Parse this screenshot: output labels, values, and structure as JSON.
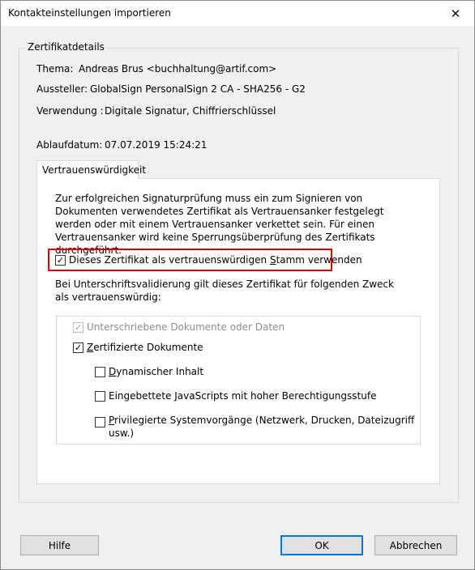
{
  "window": {
    "title": "Kontakteinstellungen importieren",
    "close_glyph": "✕"
  },
  "details": {
    "legend": "Zertifikatdetails",
    "subject_label": "Thema:",
    "subject_value": "Andreas Brus <buchhaltung@artif.com>",
    "issuer_label": "Aussteller:",
    "issuer_value": "GlobalSign PersonalSign 2 CA - SHA256 - G2",
    "usage_label": "Verwendung :",
    "usage_value": "Digitale Signatur, Chiffrierschlüssel",
    "expiry_label": "Ablaufdatum:",
    "expiry_value": "07.07.2019 15:24:21"
  },
  "tab": {
    "label": "Vertrauenswürdigkeit"
  },
  "trust": {
    "description": "Zur erfolgreichen Signaturprüfung muss ein zum Signieren von Dokumenten verwendetes Zertifikat als Vertrauensanker festgelegt werden oder mit einem Vertrauensanker verkettet sein. Für einen Vertrauensanker wird keine Sperrungsüberprüfung des Zertifikats durchgeführt.",
    "root_checkbox": {
      "label_pre": "Dieses Zertifikat als vertrauenswürdigen ",
      "label_ul": "S",
      "label_post": "tamm verwenden",
      "checked": true
    },
    "purpose_text": "Bei Unterschriftsvalidierung gilt dieses Zertifikat für folgenden Zweck als vertrauenswürdig:",
    "options": {
      "signed_docs": {
        "label": "Unterschriebene Dokumente oder Daten",
        "checked": true,
        "disabled": true
      },
      "certified_docs": {
        "label_ul": "Z",
        "label_rest": "ertifizierte Dokumente",
        "checked": true
      },
      "dynamic": {
        "label_ul": "D",
        "label_rest": "ynamischer Inhalt",
        "checked": false
      },
      "javascript": {
        "label_pre": "Eingebettete ",
        "label_ul": "J",
        "label_post": "avaScripts mit hoher Berechtigungsstufe",
        "checked": false
      },
      "privileged": {
        "line1_ul": "P",
        "line1_rest": "rivilegierte Systemvorgänge (Netzwerk, Drucken, Dateizugriff",
        "line2": "usw.)",
        "checked": false
      }
    }
  },
  "buttons": {
    "help": "Hilfe",
    "ok": "OK",
    "cancel": "Abbrechen"
  },
  "check_glyph": "✓",
  "colors": {
    "highlight_border": "#e00000",
    "default_button_border": "#0078d7",
    "panel_background": "#ffffff",
    "window_background": "#f0f0f0"
  }
}
